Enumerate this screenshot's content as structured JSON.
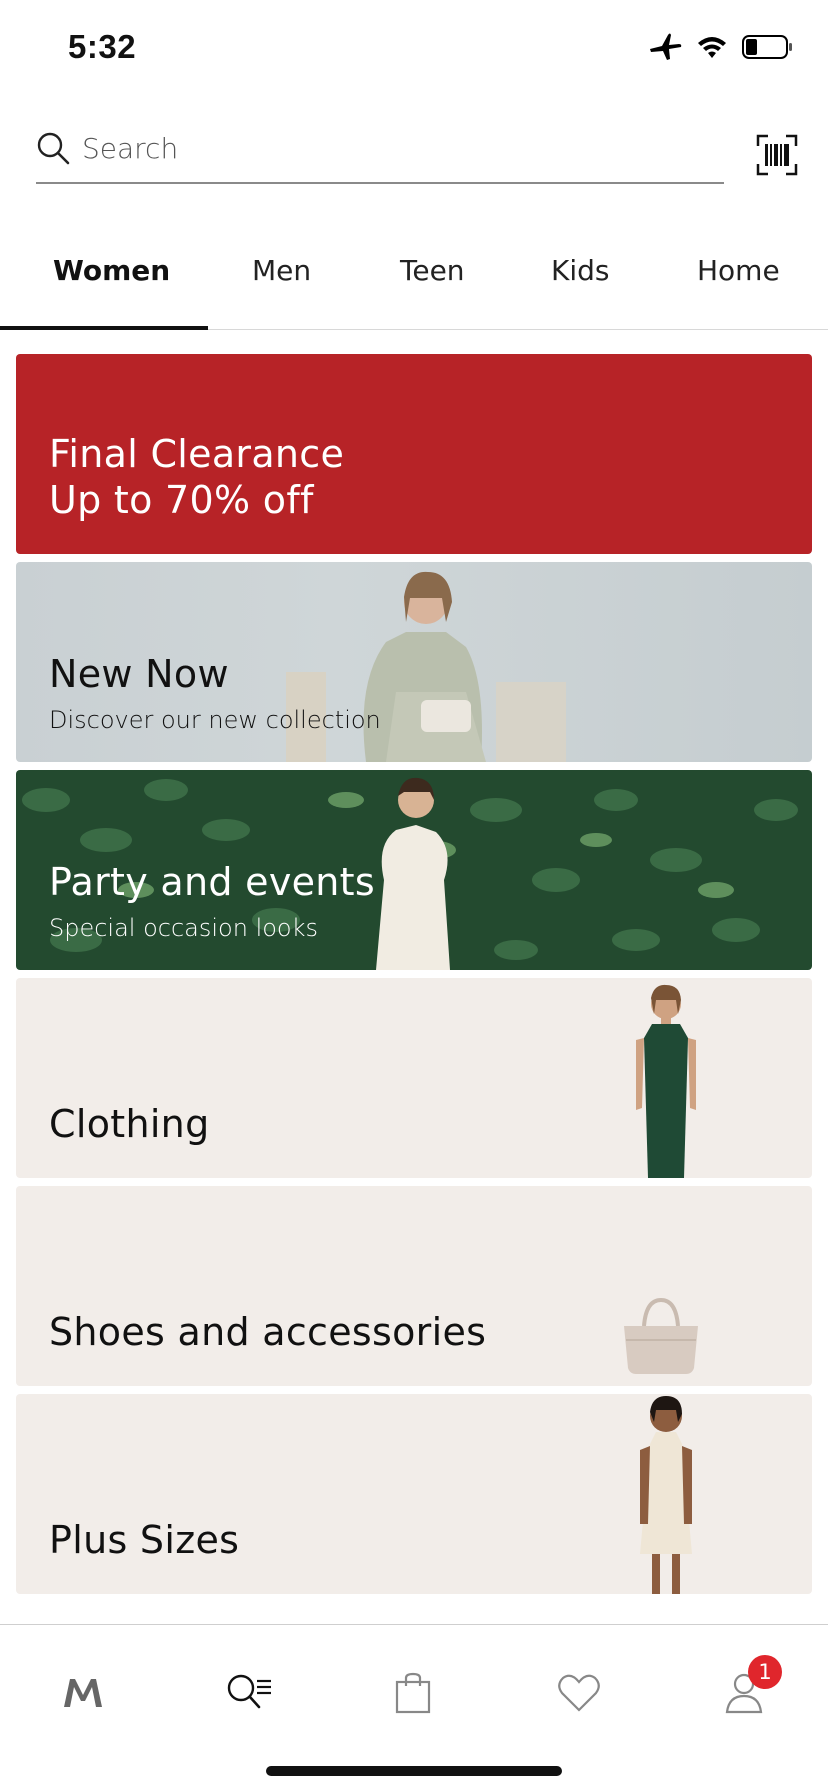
{
  "status_bar": {
    "time": "5:32",
    "icons": [
      "airplane-icon",
      "wifi-icon",
      "battery-icon"
    ]
  },
  "search": {
    "placeholder": "Search",
    "value": "",
    "icons": [
      "search-icon",
      "barcode-icon"
    ]
  },
  "tabs": [
    {
      "label": "Women",
      "active": true
    },
    {
      "label": "Men",
      "active": false
    },
    {
      "label": "Teen",
      "active": false
    },
    {
      "label": "Kids",
      "active": false
    },
    {
      "label": "Home",
      "active": false
    }
  ],
  "banners": {
    "clearance": {
      "line1": "Final Clearance",
      "line2": "Up to 70% off",
      "color": "#b72327"
    },
    "new_now": {
      "title": "New Now",
      "subtitle": "Discover our new collection"
    },
    "party": {
      "title": "Party and events",
      "subtitle": "Special occasion looks"
    },
    "clothing": {
      "title": "Clothing"
    },
    "shoes": {
      "title": "Shoes and accessories"
    },
    "plus": {
      "title": "Plus Sizes"
    }
  },
  "bottom_nav": {
    "items": [
      "brand-logo-icon",
      "search-menu-icon",
      "shopping-bag-icon",
      "heart-icon",
      "user-icon"
    ],
    "profile_badge": "1",
    "badge_color": "#e0262c"
  }
}
